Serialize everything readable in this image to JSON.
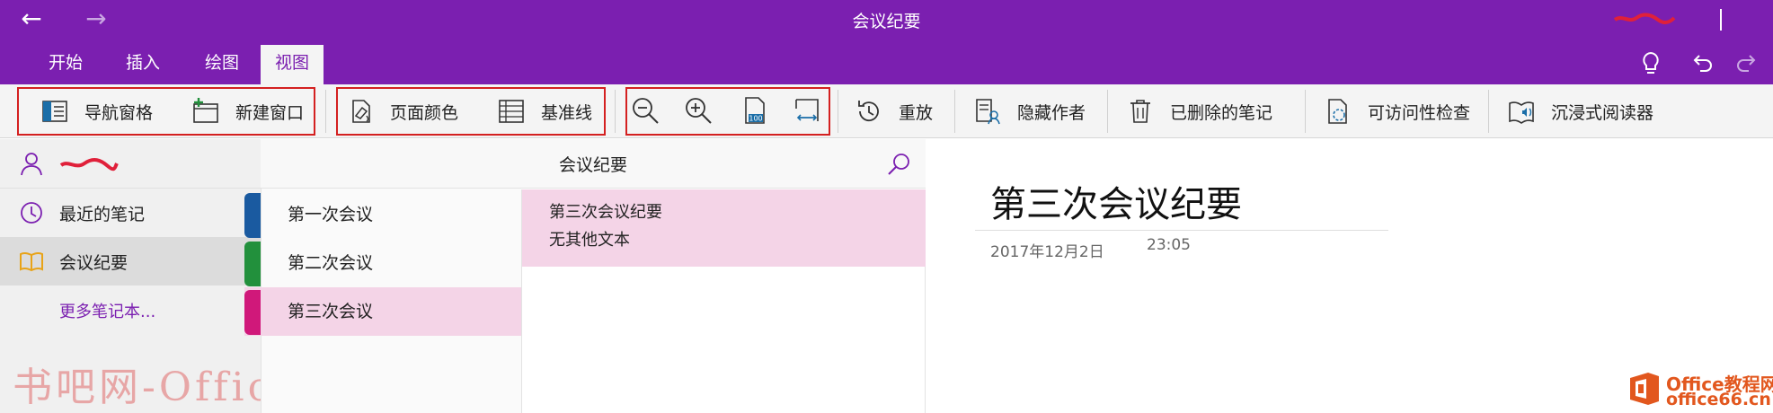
{
  "titlebar": {
    "title": "会议纪要",
    "back_glyph": "←",
    "forward_glyph": "→"
  },
  "tabs": [
    {
      "label": "开始",
      "active": false
    },
    {
      "label": "插入",
      "active": false
    },
    {
      "label": "绘图",
      "active": false
    },
    {
      "label": "视图",
      "active": true
    }
  ],
  "tab_icons": [
    "lightbulb-icon",
    "undo-icon",
    "redo-icon"
  ],
  "ribbon": {
    "nav_pane": "导航窗格",
    "new_window": "新建窗口",
    "page_color": "页面颜色",
    "rule_lines": "基准线",
    "zoom_icons": [
      "zoom-out-icon",
      "zoom-in-icon",
      "zoom-100-icon",
      "page-width-icon"
    ],
    "replay": "重放",
    "hide_authors": "隐藏作者",
    "deleted_notes": "已删除的笔记",
    "accessibility": "可访问性检查",
    "immersive_reader": "沉浸式阅读器"
  },
  "notebooks": {
    "recent": "最近的笔记",
    "current": "会议纪要",
    "more": "更多笔记本..."
  },
  "sections": {
    "title": "会议纪要",
    "items": [
      {
        "label": "第一次会议",
        "color": "#1a5aa0",
        "selected": false
      },
      {
        "label": "第二次会议",
        "color": "#22903c",
        "selected": false
      },
      {
        "label": "第三次会议",
        "color": "#d0187a",
        "selected": true
      }
    ]
  },
  "pages": [
    {
      "title": "第三次会议纪要",
      "snippet": "无其他文本"
    }
  ],
  "content": {
    "title": "第三次会议纪要",
    "date": "2017年12月2日",
    "time": "23:05"
  },
  "watermark": "书吧网-Office教程网",
  "logo": {
    "line1": "Office教程网",
    "line2": "office66.cn"
  },
  "colors": {
    "accent": "#7b1fb0",
    "highlight_box": "#d42020",
    "selected_page": "#f4d4e7"
  }
}
